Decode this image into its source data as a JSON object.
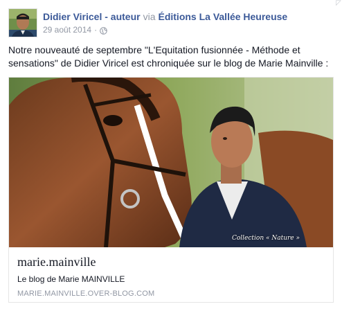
{
  "post": {
    "author": "Didier Viricel - auteur",
    "via": "via",
    "page": "Éditions La Vallée Heureuse",
    "date": "29 août 2014",
    "separator": "·",
    "audience_icon": "globe-icon",
    "text": "Notre nouveauté de septembre \"L'Equitation fusionnée - Méthode et sensations\" de Didier Viricel est chroniquée sur le blog de Marie Mainville :"
  },
  "link_card": {
    "image_caption": "Collection « Nature »",
    "title": "marie.mainville",
    "description": "Le blog de Marie MAINVILLE",
    "domain": "MARIE.MAINVILLE.OVER-BLOG.COM"
  },
  "colors": {
    "link_blue": "#3b5998",
    "meta_gray": "#9197a3",
    "text": "#141823"
  }
}
